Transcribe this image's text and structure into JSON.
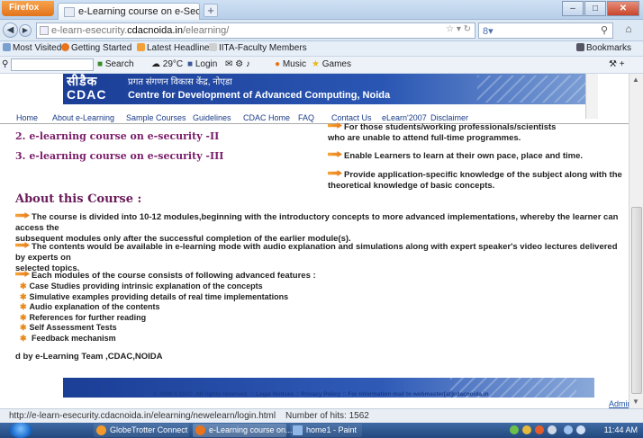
{
  "browser": {
    "app_button": "Firefox",
    "tab_title": "e-Learning course on e-Security",
    "new_tab_symbol": "+",
    "url_prefix": "e-learn-esecurity.",
    "url_domain": "cdacnoida.in",
    "url_path": "/elearning/",
    "search_engine_icon": "google-icon"
  },
  "bookmarks": {
    "items": [
      "Most Visited",
      "Getting Started",
      "Latest Headlines",
      "IITA-Faculty Members"
    ],
    "bookmarks_label": "Bookmarks"
  },
  "toolbar": {
    "search_label": "Search",
    "weather": "29°C",
    "login_label": "Login",
    "music_label": "Music",
    "games_label": "Games"
  },
  "banner": {
    "logo_hindi": "सीडैक",
    "logo_latin": "CDAC",
    "hindi_title": "प्रगत संगणन विकास केंद्र, नोएडा",
    "english_title": "Centre for Development of Advanced Computing, Noida"
  },
  "menu": [
    "Home",
    "About e-Learning",
    "Sample Courses",
    "Guidelines",
    "CDAC Home",
    "FAQ",
    "Contact Us",
    "eLearn'2007",
    "Disclaimer"
  ],
  "courses": [
    {
      "label": "2. e-learning course on e-security -II"
    },
    {
      "label": "3. e-learning course on e-security -III"
    }
  ],
  "features_right": [
    "For those students/working professionals/scientists",
    "who are unable to attend full-time programmes.",
    "Enable Learners to learn at their own pace, place and time.",
    "Provide application-specific knowledge of the subject along with the",
    "theoretical knowledge of basic concepts."
  ],
  "about": {
    "heading": "About this Course :",
    "para1_line1": "The course is divided into 10-12 modules,beginning with the introductory concepts to more advanced implementations, whereby the learner can access the",
    "para1_line2": "subsequent modules only after the successful completion of the earlier module(s).",
    "para2_line1": "The contents would be available in e-learning mode with audio explanation and simulations along with expert speaker's video lectures delivered by experts on",
    "para2_line2": "selected topics.",
    "para3": "Each modules of the course consists of following advanced features :",
    "list": [
      "Case Studies providing intrinsic explanation of the concepts",
      "Simulative examples providing details of real time implementations",
      "Audio explanation of the contents",
      "References for further reading",
      "Self Assessment Tests",
      " Feedback mechanism"
    ],
    "team": "d by e-Learning Team ,CDAC,NOIDA"
  },
  "footer": {
    "copyright": "© 2008 C-DAC. All rights reserved. :: Legal Notices :: Privacy Policy :: For information mail to webmaster[at]cdacnoida.in",
    "admin": "Admin"
  },
  "status": {
    "url": "http://e-learn-esecurity.cdacnoida.in/elearning/newelearn/login.html",
    "hits": "Number of hits:  1562"
  },
  "taskbar": {
    "items": [
      "GlobeTrotter Connect",
      "e-Learning course on...",
      "home1 - Paint"
    ],
    "clock": "11:44 AM"
  },
  "colors": {
    "accent": "#1b3e96",
    "link": "#7b1d6a",
    "arrow": "#e8791a"
  }
}
